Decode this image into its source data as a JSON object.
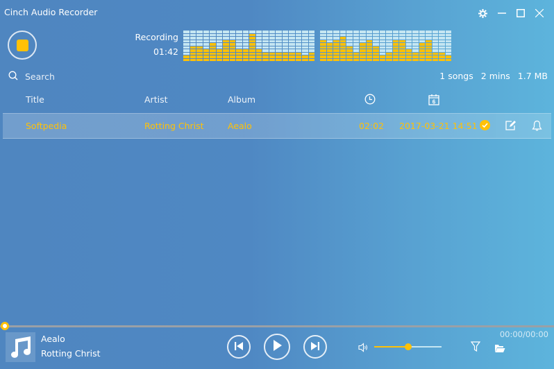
{
  "app": {
    "title": "Cinch Audio Recorder"
  },
  "window_controls": [
    {
      "name": "settings-icon"
    },
    {
      "name": "minimize-icon"
    },
    {
      "name": "maximize-icon"
    },
    {
      "name": "close-icon"
    }
  ],
  "recorder": {
    "status": "Recording",
    "elapsed": "01:42",
    "stop_icon": "stop-icon",
    "equalizer_max_level": 10,
    "equalizer_left_levels": [
      2,
      5,
      5,
      4,
      6,
      4,
      7,
      7,
      4,
      4,
      9,
      4,
      3,
      3,
      3,
      3,
      3,
      3,
      2,
      3
    ],
    "equalizer_right_levels": [
      7,
      6,
      7,
      8,
      5,
      3,
      6,
      7,
      5,
      2,
      3,
      7,
      7,
      4,
      3,
      6,
      7,
      3,
      3,
      2
    ]
  },
  "search": {
    "placeholder": "Search",
    "value": ""
  },
  "stats": {
    "songs": "1 songs",
    "duration": "2 mins",
    "size": "1.7 MB"
  },
  "table": {
    "headers": {
      "title": "Title",
      "artist": "Artist",
      "album": "Album",
      "duration_icon": "clock-icon",
      "date_icon": "calendar-icon",
      "calendar_day": "6"
    },
    "rows": [
      {
        "title": "Softpedia",
        "artist": "Rotting Christ",
        "album": "Aealo",
        "duration": "02:02",
        "date": "2017-03-21 14:51"
      }
    ]
  },
  "player": {
    "album": "Aealo",
    "artist": "Rotting Christ",
    "time": "00:00/00:00",
    "progress": 0,
    "volume": 0.5
  },
  "colors": {
    "accent": "#ffc107",
    "eq_off": "#c5e6f2"
  }
}
